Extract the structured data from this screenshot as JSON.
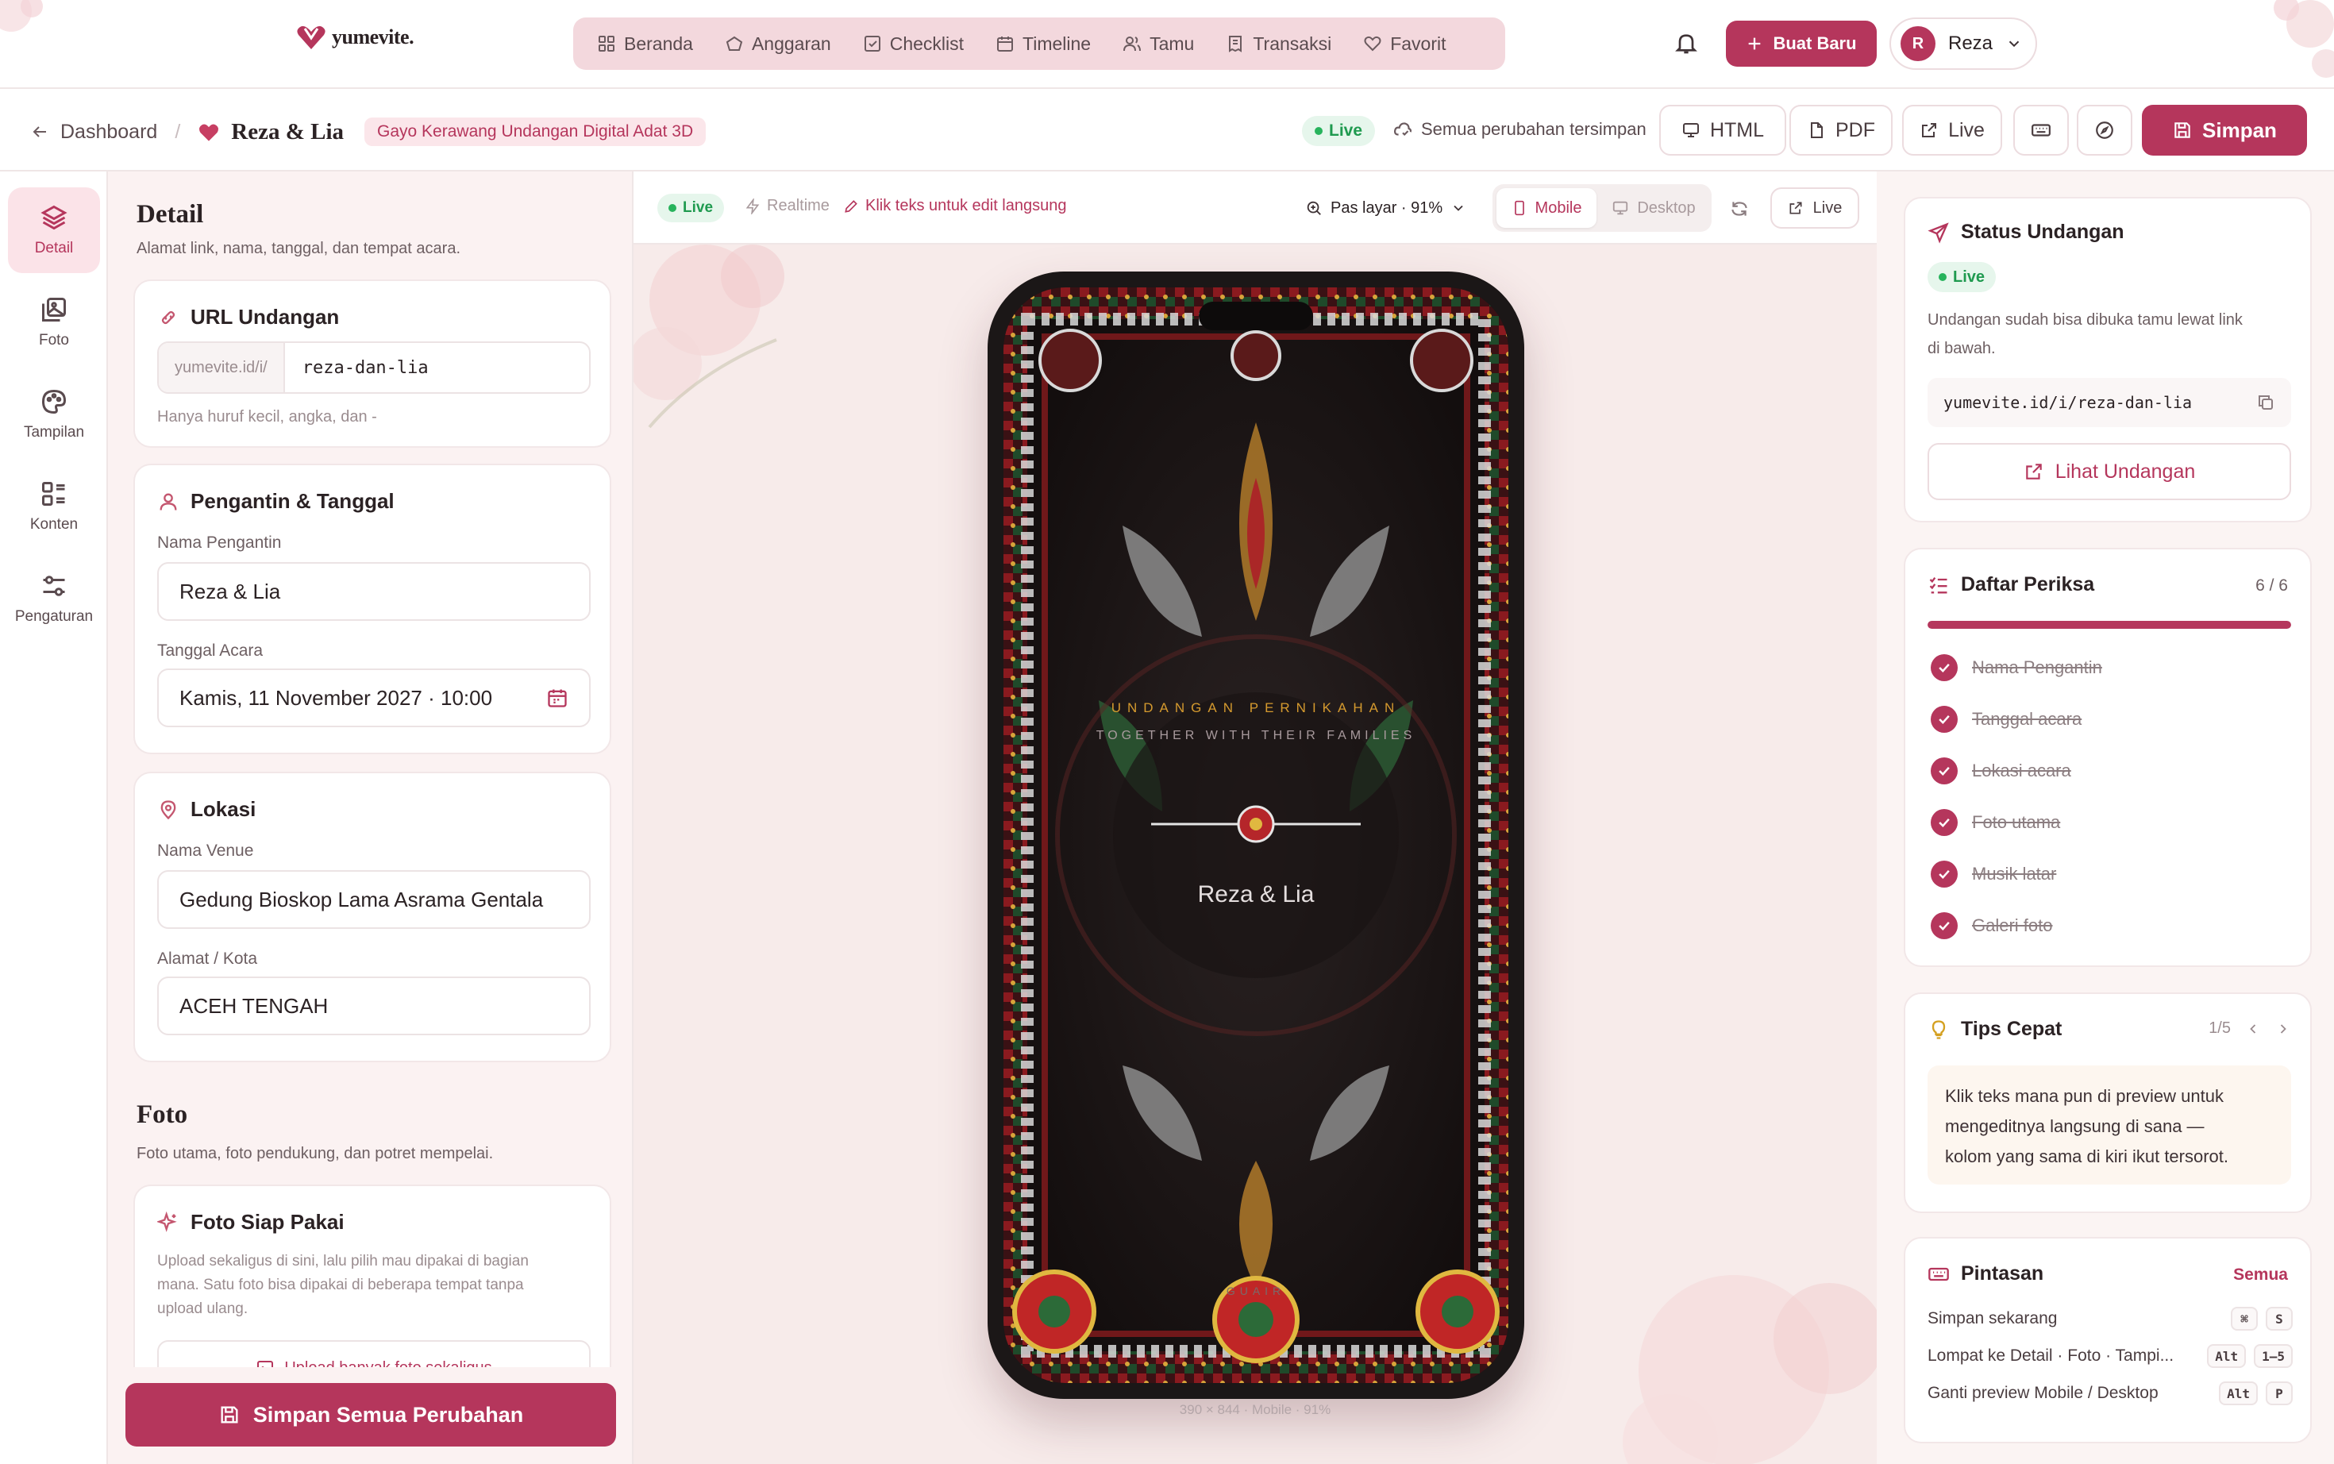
{
  "app": {
    "brand": "yumevite.",
    "colors": {
      "accent": "#b5365c",
      "live": "#27b35c",
      "panel_bg": "#fbf2f2"
    }
  },
  "nav": {
    "items": [
      {
        "label": "Beranda",
        "icon": "grid-icon"
      },
      {
        "label": "Anggaran",
        "icon": "wallet-icon"
      },
      {
        "label": "Checklist",
        "icon": "checkbox-icon"
      },
      {
        "label": "Timeline",
        "icon": "calendar-icon"
      },
      {
        "label": "Tamu",
        "icon": "users-icon"
      },
      {
        "label": "Transaksi",
        "icon": "receipt-icon"
      },
      {
        "label": "Favorit",
        "icon": "heart-icon"
      }
    ],
    "create_label": "Buat Baru",
    "user_initial": "R",
    "user_name": "Reza"
  },
  "subbar": {
    "breadcrumb_root": "Dashboard",
    "separator": "/",
    "project_title": "Reza & Lia",
    "template_tag": "Gayo Kerawang Undangan Digital Adat 3D",
    "live_label": "Live",
    "saved_status": "Semua perubahan tersimpan",
    "html_label": "HTML",
    "pdf_label": "PDF",
    "live_btn_label": "Live",
    "save_label": "Simpan"
  },
  "rail": {
    "items": [
      {
        "label": "Detail",
        "icon": "layers-icon"
      },
      {
        "label": "Foto",
        "icon": "images-icon"
      },
      {
        "label": "Tampilan",
        "icon": "palette-icon"
      },
      {
        "label": "Konten",
        "icon": "blocks-icon"
      },
      {
        "label": "Pengaturan",
        "icon": "sliders-icon"
      }
    ]
  },
  "form": {
    "detail_title": "Detail",
    "detail_sub": "Alamat link, nama, tanggal, dan tempat acara.",
    "url_card_title": "URL Undangan",
    "url_prefix": "yumevite.id/i/",
    "url_slug": "reza-dan-lia",
    "url_hint": "Hanya huruf kecil, angka, dan -",
    "couple_card_title": "Pengantin & Tanggal",
    "couple_label": "Nama Pengantin",
    "couple_value": "Reza & Lia",
    "date_label": "Tanggal Acara",
    "date_value": "Kamis, 11 November 2027 · 10:00",
    "location_card_title": "Lokasi",
    "venue_label": "Nama Venue",
    "venue_value": "Gedung Bioskop Lama Asrama Gentala",
    "address_label": "Alamat / Kota",
    "address_value": "ACEH TENGAH",
    "photo_title": "Foto",
    "photo_sub": "Foto utama, foto pendukung, dan potret mempelai.",
    "photo_card_title": "Foto Siap Pakai",
    "photo_card_desc_1": "Upload sekaligus di sini, lalu pilih mau dipakai di bagian",
    "photo_card_desc_2": "mana. Satu foto bisa dipakai di beberapa tempat tanpa",
    "photo_card_desc_3": "upload ulang.",
    "upload_bulk_label": "Upload banyak foto sekaligus",
    "save_all_label": "Simpan Semua Perubahan"
  },
  "preview": {
    "live_label": "Live",
    "realtime_label": "Realtime",
    "edit_hint": "Klik teks untuk edit langsung",
    "zoom_label": "Pas layar · 91%",
    "mobile_label": "Mobile",
    "desktop_label": "Desktop",
    "live_btn_label": "Live",
    "invite_heading": "UNDANGAN PERNIKAHAN",
    "invite_subheading": "TOGETHER WITH THEIR FAMILIES",
    "invite_names": "Reza & Lia",
    "invite_footer": "GUAIR",
    "caption": "390 × 844 · Mobile · 91%"
  },
  "status_card": {
    "title": "Status Undangan",
    "live_label": "Live",
    "desc_1": "Undangan sudah bisa dibuka tamu lewat link",
    "desc_2": "di bawah.",
    "link": "yumevite.id/i/reza-dan-lia",
    "view_label": "Lihat Undangan"
  },
  "checklist_card": {
    "title": "Daftar Periksa",
    "count": "6 / 6",
    "progress": 1.0,
    "items": [
      "Nama Pengantin",
      "Tanggal acara",
      "Lokasi acara",
      "Foto utama",
      "Musik latar",
      "Galeri foto"
    ]
  },
  "tips_card": {
    "title": "Tips Cepat",
    "page": "1/5",
    "text_1": "Klik teks mana pun di preview untuk",
    "text_2": "mengeditnya langsung di sana —",
    "text_3": "kolom yang sama di kiri ikut tersorot."
  },
  "shortcuts_card": {
    "title": "Pintasan",
    "all_label": "Semua",
    "rows": [
      {
        "label": "Simpan sekarang",
        "keys": [
          "⌘",
          "S"
        ]
      },
      {
        "label": "Lompat ke Detail · Foto · Tampi...",
        "keys": [
          "Alt",
          "1–5"
        ]
      },
      {
        "label": "Ganti preview Mobile / Desktop",
        "keys": [
          "Alt",
          "P"
        ]
      }
    ]
  }
}
